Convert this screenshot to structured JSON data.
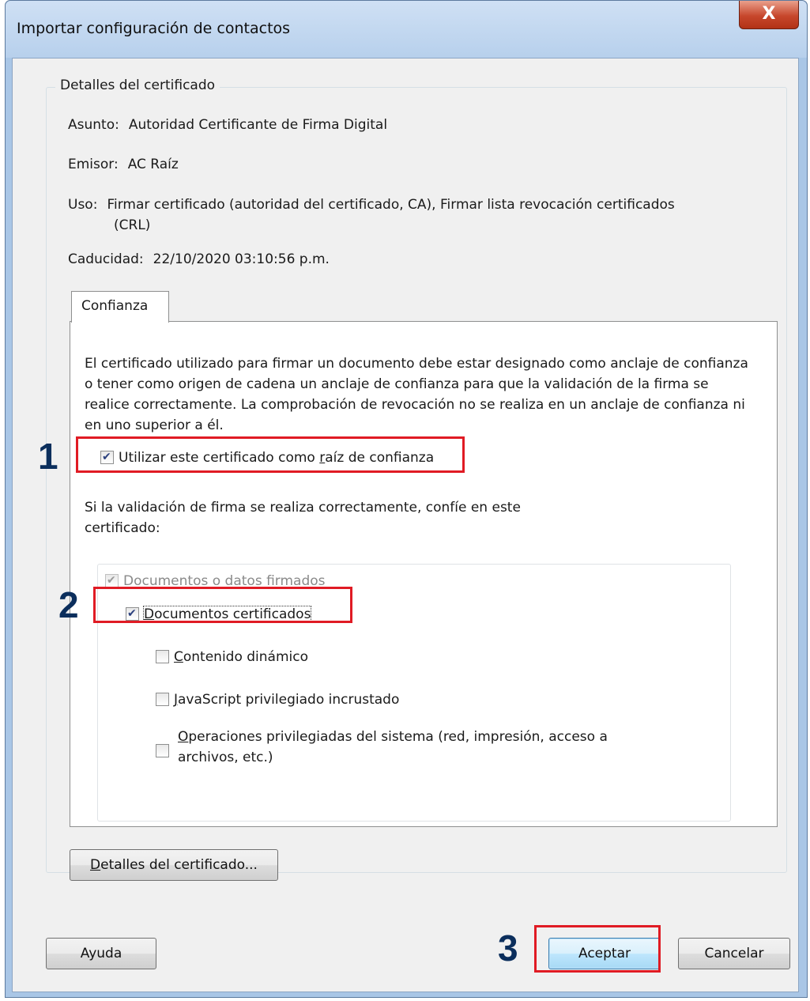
{
  "window": {
    "title": "Importar configuración de contactos",
    "close_glyph": "X"
  },
  "group": {
    "legend": "Detalles del certificado",
    "subject_label": "Asunto:",
    "subject_value": "Autoridad Certificante de Firma Digital",
    "issuer_label": "Emisor:",
    "issuer_value": "AC Raíz",
    "usage_label": "Uso:",
    "usage_value_line1": "Firmar certificado (autoridad del certificado, CA), Firmar lista revocación certificados",
    "usage_value_line2": "(CRL)",
    "expiry_label": "Caducidad:",
    "expiry_value": "22/10/2020 03:10:56 p.m."
  },
  "tab": {
    "label": "Confianza",
    "paragraph": "El certificado utilizado para firmar un documento debe estar designado como anclaje de confianza o tener como origen de cadena un anclaje de confianza para que la validación de la firma se realice correctamente. La comprobación de revocación no se realiza en un anclaje de confianza ni en uno superior a él.",
    "root_checkbox": {
      "label_before": "Utilizar este certificado como ",
      "label_accel": "r",
      "label_after": "aíz de confianza",
      "checked": true
    },
    "trust_text_line1": "Si la validación de firma se realiza correctamente, confíe en este",
    "trust_text_line2": "certificado:",
    "options": {
      "signed_docs": {
        "label": "Documentos o datos firmados",
        "checked": true,
        "disabled": true
      },
      "certified_docs": {
        "label_accel": "D",
        "label_after": "ocumentos certificados",
        "checked": true
      },
      "dynamic_content": {
        "label_accel": "C",
        "label_after": "ontenido dinámico",
        "checked": false
      },
      "js_privileged": {
        "label_accel": "J",
        "label_after": "avaScript privilegiado incrustado",
        "checked": false
      },
      "system_ops": {
        "label_accel": "O",
        "label_after_line1": "peraciones privilegiadas del sistema (red, impresión, acceso a",
        "label_line2": "archivos, etc.)",
        "checked": false
      }
    }
  },
  "buttons": {
    "cert_details_accel": "D",
    "cert_details_after": "etalles del certificado...",
    "help": "Ayuda",
    "accept": "Aceptar",
    "cancel": "Cancelar"
  },
  "annotations": {
    "step1": "1",
    "step2": "2",
    "step3": "3",
    "highlight_color": "#e01b24",
    "number_color": "#0b2e5c"
  }
}
